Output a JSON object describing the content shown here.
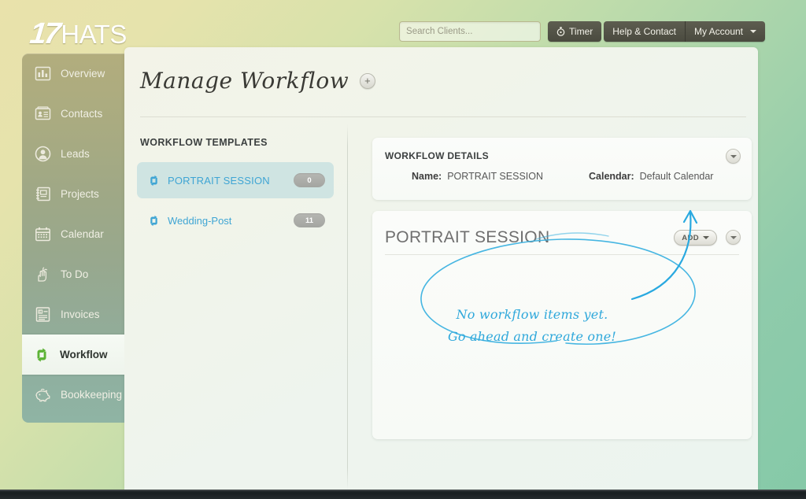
{
  "brand": {
    "number": "17",
    "word": "HATS"
  },
  "header": {
    "search": {
      "placeholder": "Search Clients...",
      "value": ""
    },
    "timer_label": "Timer",
    "timer_icon": "stopwatch-icon",
    "help_label": "Help & Contact",
    "account_label": "My Account",
    "account_caret_icon": "caret-down-icon"
  },
  "sidebar": {
    "items": [
      {
        "label": "Overview",
        "icon": "bar-chart-icon",
        "active": false
      },
      {
        "label": "Contacts",
        "icon": "contact-card-icon",
        "active": false
      },
      {
        "label": "Leads",
        "icon": "person-circle-icon",
        "active": false
      },
      {
        "label": "Projects",
        "icon": "notebook-icon",
        "active": false
      },
      {
        "label": "Calendar",
        "icon": "calendar-icon",
        "active": false
      },
      {
        "label": "To Do",
        "icon": "hand-string-icon",
        "active": false
      },
      {
        "label": "Invoices",
        "icon": "invoice-icon",
        "active": false
      },
      {
        "label": "Workflow",
        "icon": "workflow-arrows-icon",
        "active": true
      },
      {
        "label": "Bookkeeping",
        "icon": "piggy-bank-icon",
        "active": false
      }
    ]
  },
  "page": {
    "title": "Manage Workflow",
    "add_template_icon": "plus-icon"
  },
  "templates": {
    "heading": "WORKFLOW TEMPLATES",
    "items": [
      {
        "name": "PORTRAIT SESSION",
        "count": "0",
        "icon": "workflow-arrows-icon",
        "selected": true
      },
      {
        "name": "Wedding-Post",
        "count": "11",
        "icon": "workflow-arrows-icon",
        "selected": false
      }
    ]
  },
  "details": {
    "heading": "WORKFLOW DETAILS",
    "name_label": "Name:",
    "name_value": "PORTRAIT SESSION",
    "calendar_label": "Calendar:",
    "calendar_value": "Default Calendar",
    "collapse_icon": "chevron-down-icon"
  },
  "session": {
    "title": "PORTRAIT SESSION",
    "add_label": "ADD",
    "add_caret_icon": "caret-down-icon",
    "collapse_icon": "chevron-down-icon",
    "empty_message_line1": "No workflow items yet.",
    "empty_message_line2": "Go ahead and create one!",
    "annotation_color": "#2fa8db"
  },
  "colors": {
    "accent_blue": "#3fa5d4",
    "annotation_blue": "#2fa8db",
    "workflow_green": "#5cb335",
    "selected_template_bg": "#cfe4e2",
    "bg_top_left": "#e9e2ab",
    "bg_bottom_right": "#85c9a8"
  }
}
